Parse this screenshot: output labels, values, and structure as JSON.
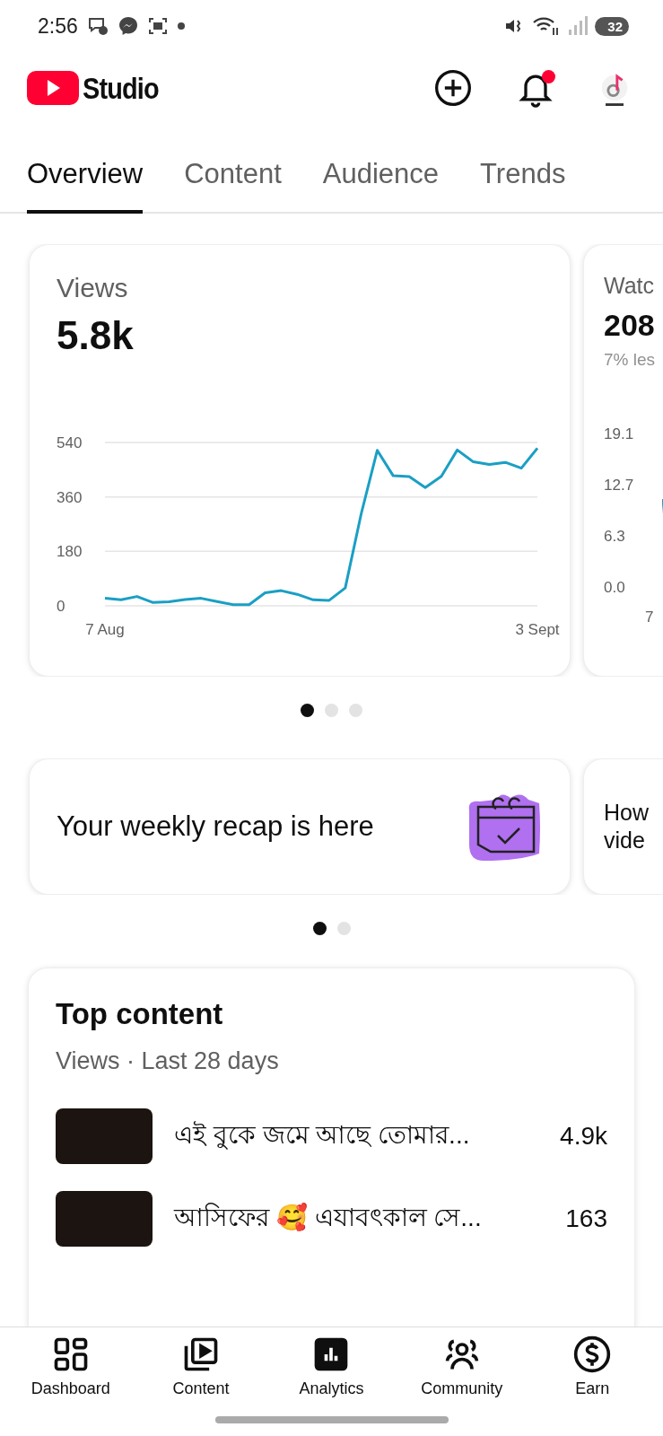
{
  "status_bar": {
    "time": "2:56",
    "battery": "32"
  },
  "header": {
    "title": "Studio",
    "notifications_unread": true
  },
  "tabs": [
    {
      "label": "Overview",
      "selected": true
    },
    {
      "label": "Content",
      "selected": false
    },
    {
      "label": "Audience",
      "selected": false
    },
    {
      "label": "Trends",
      "selected": false
    }
  ],
  "metric_cards": [
    {
      "title": "Views",
      "value": "5.8k",
      "chart_data": {
        "type": "line",
        "categories": [
          "7 Aug",
          null,
          null,
          null,
          null,
          null,
          null,
          null,
          null,
          null,
          null,
          null,
          null,
          null,
          null,
          null,
          null,
          null,
          null,
          null,
          null,
          null,
          null,
          null,
          null,
          null,
          null,
          "3 Sept"
        ],
        "ylim": [
          0,
          540
        ],
        "yticks": [
          0,
          180,
          360,
          540
        ],
        "series": [
          {
            "color": "#1a9fc4",
            "values": [
              25,
              20,
              31,
              11,
              13,
              21,
              25,
              14,
              4,
              4,
              43,
              50,
              38,
              20,
              18,
              59,
              304,
              514,
              430,
              427,
              391,
              428,
              515,
              476,
              467,
              474,
              455,
              521
            ]
          }
        ]
      }
    },
    {
      "title": "Watc",
      "value": "208",
      "change": "7% les",
      "tick_labels": [
        "19.1",
        "12.7",
        "6.3",
        "0.0"
      ],
      "x_label": "7"
    }
  ],
  "metric_pages": [
    {
      "selected": true
    },
    {
      "selected": false
    },
    {
      "selected": false
    }
  ],
  "tips": [
    {
      "text": "Your weekly recap is here"
    },
    {
      "text": "How vide"
    }
  ],
  "tip_pages": [
    {
      "selected": true
    },
    {
      "selected": false
    }
  ],
  "top_content": {
    "title": "Top content",
    "subtitle": "Views · Last 28 days",
    "rows": [
      {
        "title": "এই বুকে জমে আছে তোমার...",
        "views": "4.9k"
      },
      {
        "title": "আসিফের 🥰 এযাবৎকাল সে...",
        "views": "163"
      }
    ]
  },
  "bottom_nav": [
    {
      "label": "Dashboard",
      "selected": false
    },
    {
      "label": "Content",
      "selected": false
    },
    {
      "label": "Analytics",
      "selected": true
    },
    {
      "label": "Community",
      "selected": false
    },
    {
      "label": "Earn",
      "selected": false
    }
  ]
}
